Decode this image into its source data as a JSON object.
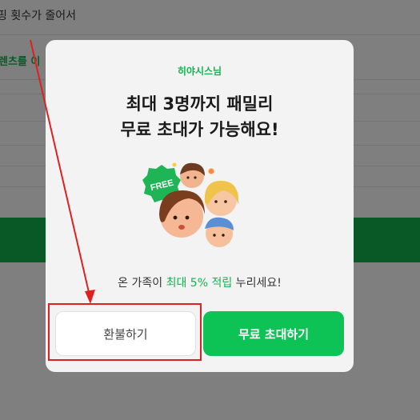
{
  "background": {
    "line1": "핑 횟수가 줄어서",
    "line2": "렌츠를 이"
  },
  "modal": {
    "greeting": "히야시스님",
    "title_line1": "최대 3명까지 패밀리",
    "title_line2": "무료 초대가 가능해요!",
    "badge": "FREE",
    "desc_pre": "온 가족이 ",
    "desc_highlight": "최대 5% 적립",
    "desc_post": " 누리세요!",
    "refund_button": "환불하기",
    "invite_button": "무료 초대하기"
  },
  "colors": {
    "accent": "#13b34f",
    "annotation": "#e02020"
  }
}
